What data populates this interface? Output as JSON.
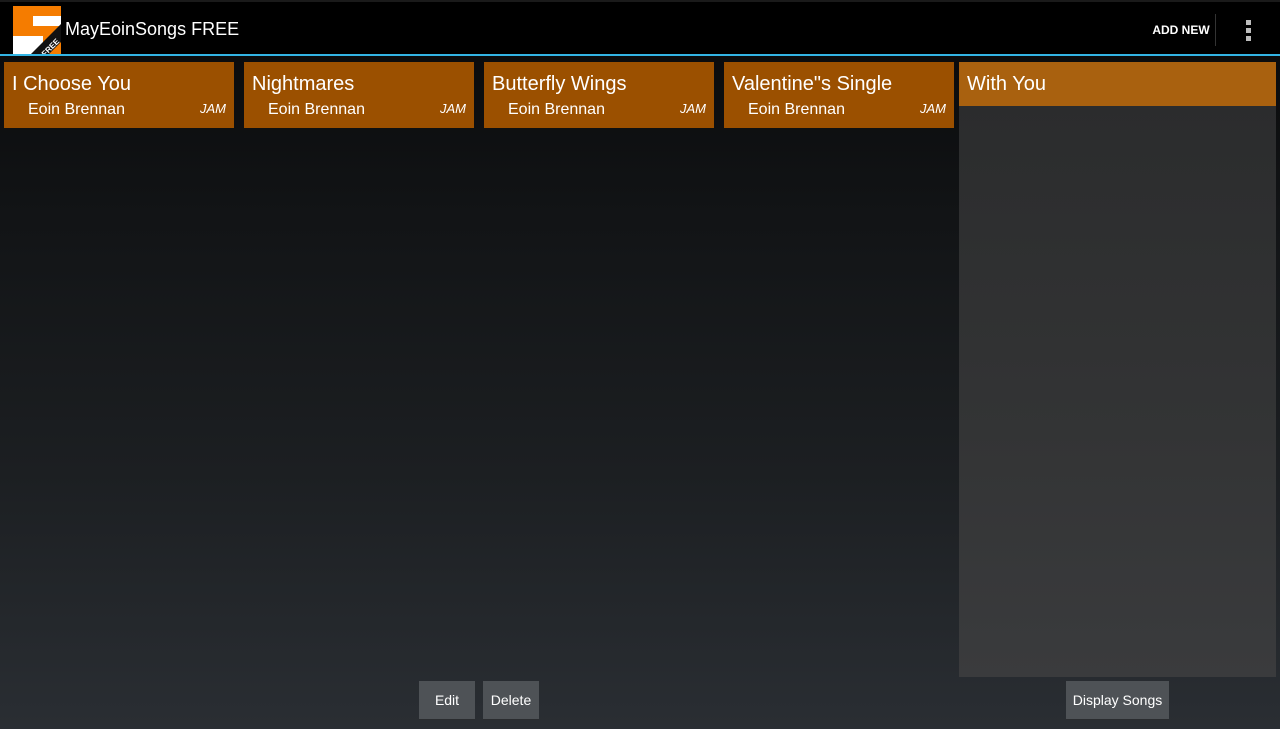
{
  "app": {
    "title": "MayEoinSongs FREE",
    "icon": "app-logo-icon",
    "icon_badge": "FREE",
    "accent_color": "#33b5e5"
  },
  "actionbar": {
    "add_new_label": "ADD NEW",
    "overflow_icon": "overflow-menu-icon"
  },
  "songs": [
    {
      "title": "I Choose You",
      "artist": "Eoin Brennan",
      "tag": "JAM"
    },
    {
      "title": "Nightmares",
      "artist": "Eoin Brennan",
      "tag": "JAM"
    },
    {
      "title": "Butterfly Wings",
      "artist": "Eoin Brennan",
      "tag": "JAM"
    },
    {
      "title": "Valentine\"s Single",
      "artist": "Eoin Brennan",
      "tag": "JAM"
    }
  ],
  "song_tile_color": "#9b5000",
  "selected_panel": {
    "title": "With You",
    "header_color": "#a9610f"
  },
  "buttons": {
    "edit_label": "Edit",
    "delete_label": "Delete",
    "display_songs_label": "Display Songs"
  }
}
